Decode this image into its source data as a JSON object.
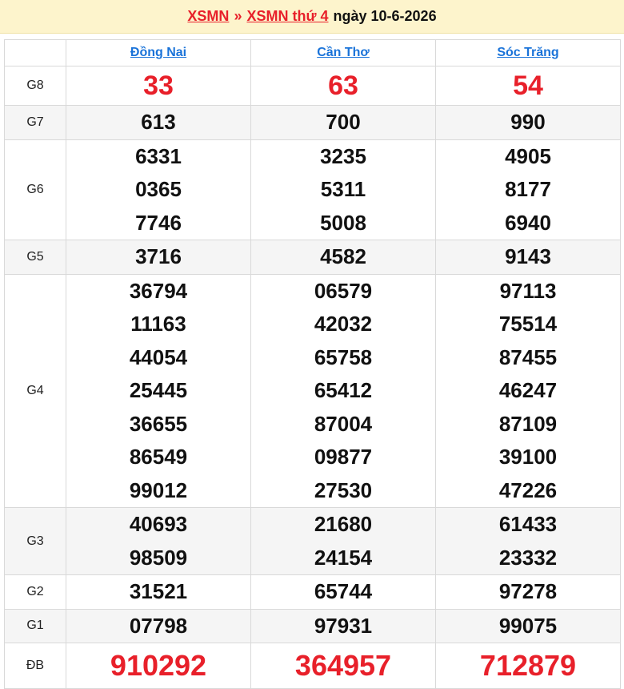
{
  "header": {
    "crumb1": "XSMN",
    "separator": "»",
    "crumb2": "XSMN thứ 4",
    "date_text": "ngày 10-6-2026"
  },
  "provinces": [
    "Đồng Nai",
    "Cần Thơ",
    "Sóc Trăng"
  ],
  "prizes": [
    {
      "label": "G8",
      "values": [
        [
          "33"
        ],
        [
          "63"
        ],
        [
          "54"
        ]
      ]
    },
    {
      "label": "G7",
      "values": [
        [
          "613"
        ],
        [
          "700"
        ],
        [
          "990"
        ]
      ]
    },
    {
      "label": "G6",
      "values": [
        [
          "6331",
          "0365",
          "7746"
        ],
        [
          "3235",
          "5311",
          "5008"
        ],
        [
          "4905",
          "8177",
          "6940"
        ]
      ]
    },
    {
      "label": "G5",
      "values": [
        [
          "3716"
        ],
        [
          "4582"
        ],
        [
          "9143"
        ]
      ]
    },
    {
      "label": "G4",
      "values": [
        [
          "36794",
          "11163",
          "44054",
          "25445",
          "36655",
          "86549",
          "99012"
        ],
        [
          "06579",
          "42032",
          "65758",
          "65412",
          "87004",
          "09877",
          "27530"
        ],
        [
          "97113",
          "75514",
          "87455",
          "46247",
          "87109",
          "39100",
          "47226"
        ]
      ]
    },
    {
      "label": "G3",
      "values": [
        [
          "40693",
          "98509"
        ],
        [
          "21680",
          "24154"
        ],
        [
          "61433",
          "23332"
        ]
      ]
    },
    {
      "label": "G2",
      "values": [
        [
          "31521"
        ],
        [
          "65744"
        ],
        [
          "97278"
        ]
      ]
    },
    {
      "label": "G1",
      "values": [
        [
          "07798"
        ],
        [
          "97931"
        ],
        [
          "99075"
        ]
      ]
    },
    {
      "label": "ĐB",
      "values": [
        [
          "910292"
        ],
        [
          "364957"
        ],
        [
          "712879"
        ]
      ]
    }
  ],
  "colors": {
    "accent_red": "#e8202a",
    "link_blue": "#1a73d9",
    "header_bg": "#fdf4cc"
  }
}
